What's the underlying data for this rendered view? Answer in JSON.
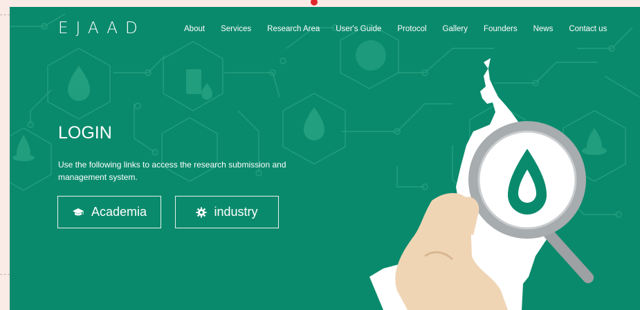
{
  "brand": "EJAAD",
  "nav": [
    "About",
    "Services",
    "Research Area",
    "User's Guide",
    "Protocol",
    "Gallery",
    "Founders",
    "News",
    "Contact us"
  ],
  "hero": {
    "title": "LOGIN",
    "description": "Use the following links to access the research submission and management system.",
    "academia_label": "Academia",
    "industry_label": "industry"
  },
  "icons": {
    "academia": "graduation-cap-icon",
    "industry": "gear-icon"
  },
  "colors": {
    "hero_bg": "#0a8a6c",
    "page_bg": "#fbebe6",
    "text": "#ffffff"
  }
}
